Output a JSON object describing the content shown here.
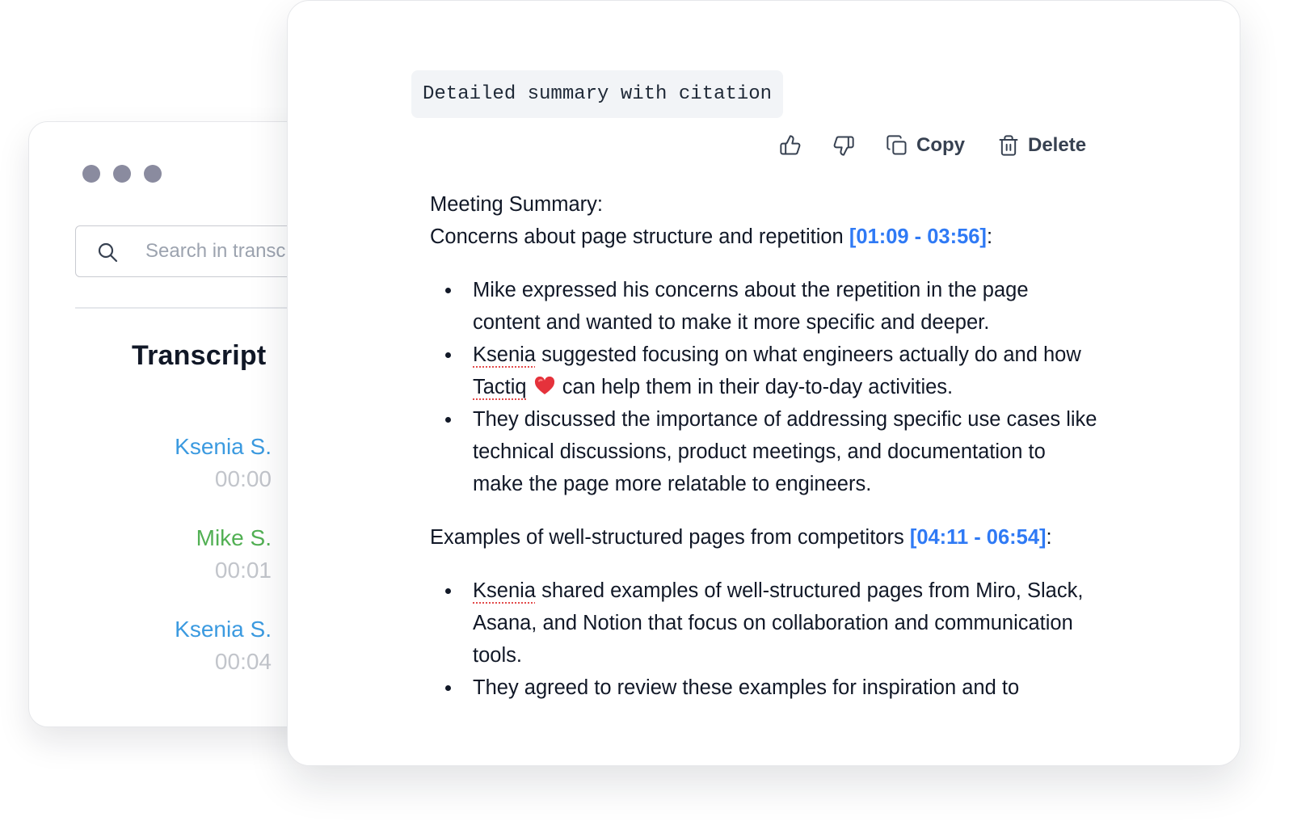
{
  "search": {
    "placeholder": "Search in transcript"
  },
  "transcript": {
    "title": "Transcript",
    "entries": [
      {
        "speaker": "Ksenia S.",
        "time": "00:00",
        "color": "#3b9ae0"
      },
      {
        "speaker": "Mike S.",
        "time": "00:01",
        "color": "#52b054"
      },
      {
        "speaker": "Ksenia S.",
        "time": "00:04",
        "color": "#3b9ae0"
      }
    ]
  },
  "prompt": {
    "label": "Detailed summary with citation"
  },
  "actions": {
    "like_icon": "thumbs-up-icon",
    "dislike_icon": "thumbs-down-icon",
    "copy_label": "Copy",
    "delete_label": "Delete"
  },
  "summary": {
    "heading": "Meeting Summary:",
    "sections": [
      {
        "title": "Concerns about page structure and repetition",
        "citation": "[01:09 - 03:56]",
        "bullets": [
          {
            "text": "Mike expressed his concerns about the repetition in the page content and wanted to make it more specific and deeper."
          },
          {
            "prefix": "Ksenia",
            "part1": " suggested focusing on what engineers actually do and how ",
            "brand": "Tactiq",
            "part2": " can help them in their day-to-day activities."
          },
          {
            "text": "They discussed the importance of addressing specific use cases like technical discussions, product meetings, and documentation to make the page more relatable to engineers."
          }
        ]
      },
      {
        "title": "Examples of well-structured pages from competitors",
        "citation": "[04:11 - 06:54]",
        "bullets": [
          {
            "prefix": "Ksenia",
            "text": " shared examples of well-structured pages from Miro, Slack, Asana, and Notion that focus on collaboration and communication tools."
          },
          {
            "text": "They agreed to review these examples for inspiration and to"
          }
        ]
      }
    ]
  },
  "colors": {
    "citation": "#2f7af5",
    "window_dots": "#8a8b9f",
    "timestamp": "#c2c5cb"
  }
}
